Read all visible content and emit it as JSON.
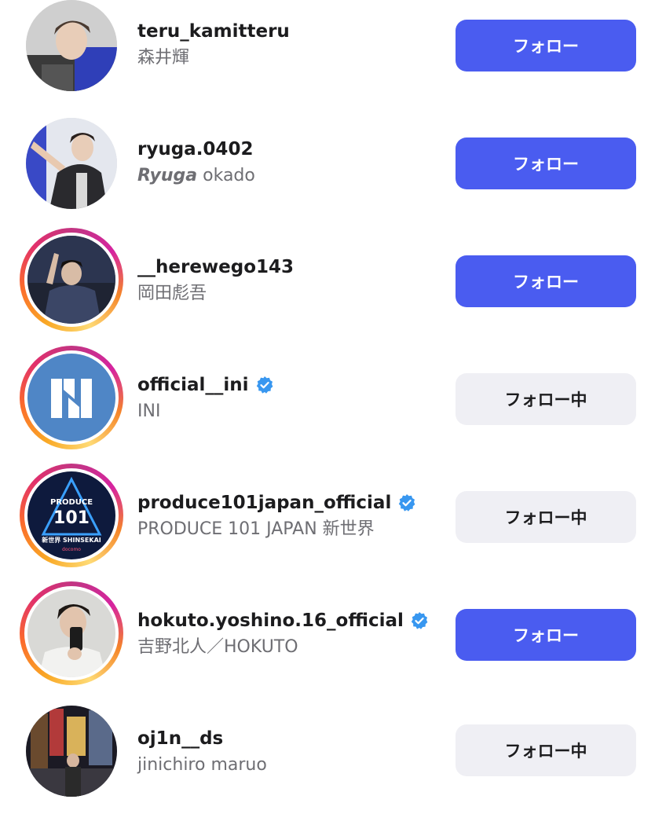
{
  "colors": {
    "follow_button": "#4a5cf0",
    "following_button": "#efeff4",
    "verified_badge": "#3897f0"
  },
  "users": [
    {
      "username": "teru_kamitteru",
      "name": "森井輝",
      "button": "フォロー",
      "verified": false,
      "story_ring": false
    },
    {
      "username": "ryuga.0402",
      "name_italic": "Ryuga",
      "name": " okado",
      "button": "フォロー",
      "verified": false,
      "story_ring": false
    },
    {
      "username": "__herewego143",
      "name": "岡田彪吾",
      "button": "フォロー",
      "verified": false,
      "story_ring": true
    },
    {
      "username": "official__ini",
      "name": "INI",
      "button": "フォロー中",
      "verified": true,
      "story_ring": true
    },
    {
      "username": "produce101japan_official",
      "name": "PRODUCE 101 JAPAN 新世界",
      "button": "フォロー中",
      "verified": true,
      "story_ring": true,
      "avatar_text": "PRODUCE 101 JAPAN 新世界 SHINSEKAI docomo"
    },
    {
      "username": "hokuto.yoshino.16_official",
      "name": "吉野北人／HOKUTO",
      "button": "フォロー",
      "verified": true,
      "story_ring": true
    },
    {
      "username": "oj1n__ds",
      "name": "jinichiro maruo",
      "button": "フォロー中",
      "verified": false,
      "story_ring": false
    }
  ]
}
